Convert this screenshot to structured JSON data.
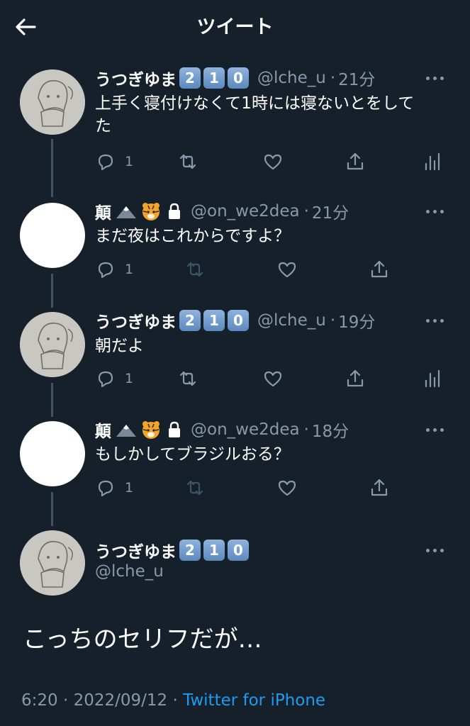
{
  "header": {
    "title": "ツイート",
    "back_icon": "arrow-left-icon"
  },
  "colors": {
    "background": "#15202b",
    "secondary_text": "#8b98a5",
    "link": "#1d9bf0",
    "thread_line": "#3d5466"
  },
  "tweets": [
    {
      "name": "うつぎゆま",
      "badges": [
        "2",
        "1",
        "0"
      ],
      "handle": "@lche_u",
      "time": "21分",
      "text_line1": "上手く寝付けなくて1時には寝ないとをして",
      "text_line2": "た",
      "reply_count": "1"
    },
    {
      "name": "顛",
      "handle": "@on_we2dea",
      "time": "21分",
      "text": "まだ夜はこれからですよ？",
      "reply_count": "1"
    },
    {
      "name": "うつぎゆま",
      "badges": [
        "2",
        "1",
        "0"
      ],
      "handle": "@lche_u",
      "time": "19分",
      "text": "朝だよ",
      "reply_count": "1"
    },
    {
      "name": "顛",
      "handle": "@on_we2dea",
      "time": "18分",
      "text": "もしかしてブラジルおる？",
      "reply_count": "1"
    }
  ],
  "main_tweet": {
    "name": "うつぎゆま",
    "badges": [
      "2",
      "1",
      "0"
    ],
    "handle": "@lche_u",
    "text": "こっちのセリフだが…",
    "time": "6:20",
    "date": "2022/09/12",
    "separator": "·",
    "source": "Twitter for iPhone"
  }
}
